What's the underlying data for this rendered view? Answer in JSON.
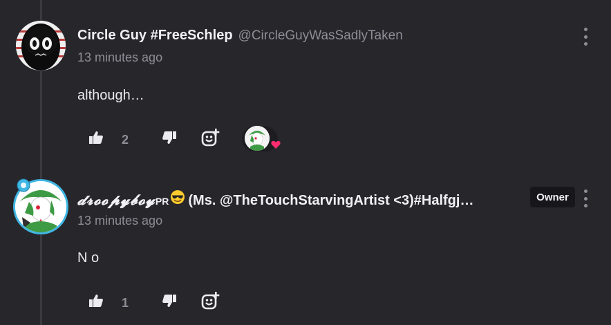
{
  "comments": [
    {
      "author": "Circle Guy #FreeSchlep",
      "handle": "@CircleGuyWasSadlyTaken",
      "timestamp": "13 minutes ago",
      "body": "although…",
      "likes": "2",
      "avatar_icon": "creepy-figure-avatar",
      "reactions": [
        {
          "icon": "gardevoir-avatar",
          "badge_icon": "heart-icon",
          "badge_color": "#ff2d6f"
        }
      ]
    },
    {
      "author_styled": "𝓭𝓻𝓸𝓸𝓹𝔂𝓫𝓸𝔂",
      "author_sup": "PR",
      "author_emoji": "sunglasses-emoji",
      "author_rest": "(Ms. @TheTouchStarvingArtist <3)#Halfgj…",
      "badge": "Owner",
      "timestamp": "13 minutes ago",
      "body": "N o",
      "likes": "1",
      "avatar_icon": "gardevoir-avatar",
      "avatar_ring_color": "#3fb6e4"
    }
  ],
  "colors": {
    "background": "#27262b",
    "text": "#ecebef",
    "muted": "#8f8d96",
    "badge_bg": "#17161a",
    "thread_line": "#3b3a40"
  }
}
